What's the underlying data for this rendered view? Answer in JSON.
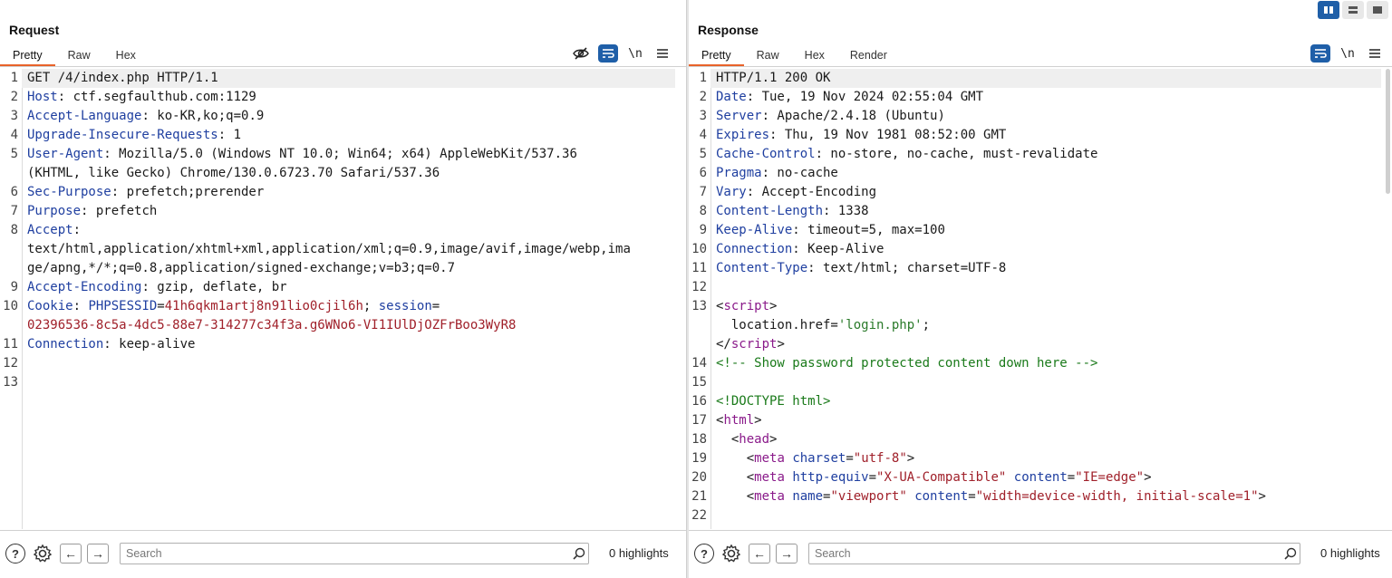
{
  "request": {
    "title": "Request",
    "tabs": [
      {
        "label": "Pretty",
        "active": true
      },
      {
        "label": "Raw"
      },
      {
        "label": "Hex"
      }
    ],
    "tools": {
      "newline_label": "\\n"
    },
    "lines": [
      {
        "n": "1",
        "segments": [
          {
            "t": "GET /4/index.php HTTP/1.1"
          }
        ],
        "highlight": true
      },
      {
        "n": "2",
        "segments": [
          {
            "t": "Host",
            "c": "hk"
          },
          {
            "t": ": ctf.segfaulthub.com:1129"
          }
        ]
      },
      {
        "n": "3",
        "segments": [
          {
            "t": "Accept-Language",
            "c": "hk"
          },
          {
            "t": ": ko-KR,ko;q=0.9"
          }
        ]
      },
      {
        "n": "4",
        "segments": [
          {
            "t": "Upgrade-Insecure-Requests",
            "c": "hk"
          },
          {
            "t": ": 1"
          }
        ]
      },
      {
        "n": "5",
        "segments": [
          {
            "t": "User-Agent",
            "c": "hk"
          },
          {
            "t": ": Mozilla/5.0 (Windows NT 10.0; Win64; x64) AppleWebKit/537.36"
          }
        ]
      },
      {
        "n": "",
        "segments": [
          {
            "t": "(KHTML, like Gecko) Chrome/130.0.6723.70 Safari/537.36"
          }
        ]
      },
      {
        "n": "6",
        "segments": [
          {
            "t": "Sec-Purpose",
            "c": "hk"
          },
          {
            "t": ": prefetch;prerender"
          }
        ]
      },
      {
        "n": "7",
        "segments": [
          {
            "t": "Purpose",
            "c": "hk"
          },
          {
            "t": ": prefetch"
          }
        ]
      },
      {
        "n": "8",
        "segments": [
          {
            "t": "Accept",
            "c": "hk"
          },
          {
            "t": ":"
          }
        ]
      },
      {
        "n": "",
        "segments": [
          {
            "t": "text/html,application/xhtml+xml,application/xml;q=0.9,image/avif,image/webp,ima"
          }
        ]
      },
      {
        "n": "",
        "segments": [
          {
            "t": "ge/apng,*/*;q=0.8,application/signed-exchange;v=b3;q=0.7"
          }
        ]
      },
      {
        "n": "9",
        "segments": [
          {
            "t": "Accept-Encoding",
            "c": "hk"
          },
          {
            "t": ": gzip, deflate, br"
          }
        ]
      },
      {
        "n": "10",
        "segments": [
          {
            "t": "Cookie",
            "c": "hk"
          },
          {
            "t": ": "
          },
          {
            "t": "PHPSESSID",
            "c": "ck"
          },
          {
            "t": "="
          },
          {
            "t": "41h6qkm1artj8n91lio0cjil6h",
            "c": "cv"
          },
          {
            "t": "; "
          },
          {
            "t": "session",
            "c": "ck"
          },
          {
            "t": "="
          }
        ]
      },
      {
        "n": "",
        "segments": [
          {
            "t": "02396536-8c5a-4dc5-88e7-314277c34f3a.g6WNo6-VI1IUlDjOZFrBoo3WyR8",
            "c": "cv"
          }
        ]
      },
      {
        "n": "11",
        "segments": [
          {
            "t": "Connection",
            "c": "hk"
          },
          {
            "t": ": keep-alive"
          }
        ]
      },
      {
        "n": "12",
        "segments": [
          {
            "t": ""
          }
        ]
      },
      {
        "n": "13",
        "segments": [
          {
            "t": ""
          }
        ]
      }
    ],
    "search": {
      "placeholder": "Search",
      "highlights": "0 highlights"
    }
  },
  "response": {
    "title": "Response",
    "tabs": [
      {
        "label": "Pretty",
        "active": true
      },
      {
        "label": "Raw"
      },
      {
        "label": "Hex"
      },
      {
        "label": "Render"
      }
    ],
    "tools": {
      "newline_label": "\\n"
    },
    "lines": [
      {
        "n": "1",
        "segments": [
          {
            "t": "HTTP/1.1 200 OK"
          }
        ],
        "highlight": true
      },
      {
        "n": "2",
        "segments": [
          {
            "t": "Date",
            "c": "hk"
          },
          {
            "t": ": Tue, 19 Nov 2024 02:55:04 GMT"
          }
        ]
      },
      {
        "n": "3",
        "segments": [
          {
            "t": "Server",
            "c": "hk"
          },
          {
            "t": ": Apache/2.4.18 (Ubuntu)"
          }
        ]
      },
      {
        "n": "4",
        "segments": [
          {
            "t": "Expires",
            "c": "hk"
          },
          {
            "t": ": Thu, 19 Nov 1981 08:52:00 GMT"
          }
        ]
      },
      {
        "n": "5",
        "segments": [
          {
            "t": "Cache-Control",
            "c": "hk"
          },
          {
            "t": ": no-store, no-cache, must-revalidate"
          }
        ]
      },
      {
        "n": "6",
        "segments": [
          {
            "t": "Pragma",
            "c": "hk"
          },
          {
            "t": ": no-cache"
          }
        ]
      },
      {
        "n": "7",
        "segments": [
          {
            "t": "Vary",
            "c": "hk"
          },
          {
            "t": ": Accept-Encoding"
          }
        ]
      },
      {
        "n": "8",
        "segments": [
          {
            "t": "Content-Length",
            "c": "hk"
          },
          {
            "t": ": 1338"
          }
        ]
      },
      {
        "n": "9",
        "segments": [
          {
            "t": "Keep-Alive",
            "c": "hk"
          },
          {
            "t": ": timeout=5, max=100"
          }
        ]
      },
      {
        "n": "10",
        "segments": [
          {
            "t": "Connection",
            "c": "hk"
          },
          {
            "t": ": Keep-Alive"
          }
        ]
      },
      {
        "n": "11",
        "segments": [
          {
            "t": "Content-Type",
            "c": "hk"
          },
          {
            "t": ": text/html; charset=UTF-8"
          }
        ]
      },
      {
        "n": "12",
        "segments": [
          {
            "t": ""
          }
        ]
      },
      {
        "n": "13",
        "segments": [
          {
            "t": "<"
          },
          {
            "t": "script",
            "c": "tg"
          },
          {
            "t": ">"
          }
        ]
      },
      {
        "n": "",
        "segments": [
          {
            "t": "  location.href="
          },
          {
            "t": "'login.php'",
            "c": "av"
          },
          {
            "t": ";"
          }
        ]
      },
      {
        "n": "",
        "segments": [
          {
            "t": "</"
          },
          {
            "t": "script",
            "c": "tg"
          },
          {
            "t": ">"
          }
        ]
      },
      {
        "n": "14",
        "segments": [
          {
            "t": "<!-- Show password protected content down here -->",
            "c": "cm"
          }
        ]
      },
      {
        "n": "15",
        "segments": [
          {
            "t": ""
          }
        ]
      },
      {
        "n": "16",
        "segments": [
          {
            "t": "<!DOCTYPE html>",
            "c": "cm"
          }
        ]
      },
      {
        "n": "17",
        "segments": [
          {
            "t": "<"
          },
          {
            "t": "html",
            "c": "tg"
          },
          {
            "t": ">"
          }
        ]
      },
      {
        "n": "18",
        "segments": [
          {
            "t": "  <"
          },
          {
            "t": "head",
            "c": "tg"
          },
          {
            "t": ">"
          }
        ]
      },
      {
        "n": "19",
        "segments": [
          {
            "t": "    <"
          },
          {
            "t": "meta",
            "c": "tg"
          },
          {
            "t": " "
          },
          {
            "t": "charset",
            "c": "at"
          },
          {
            "t": "="
          },
          {
            "t": "\"utf-8\"",
            "c": "cv"
          },
          {
            "t": ">"
          }
        ]
      },
      {
        "n": "20",
        "segments": [
          {
            "t": "    <"
          },
          {
            "t": "meta",
            "c": "tg"
          },
          {
            "t": " "
          },
          {
            "t": "http-equiv",
            "c": "at"
          },
          {
            "t": "="
          },
          {
            "t": "\"X-UA-Compatible\"",
            "c": "cv"
          },
          {
            "t": " "
          },
          {
            "t": "content",
            "c": "at"
          },
          {
            "t": "="
          },
          {
            "t": "\"IE=edge\"",
            "c": "cv"
          },
          {
            "t": ">"
          }
        ]
      },
      {
        "n": "21",
        "segments": [
          {
            "t": "    <"
          },
          {
            "t": "meta",
            "c": "tg"
          },
          {
            "t": " "
          },
          {
            "t": "name",
            "c": "at"
          },
          {
            "t": "="
          },
          {
            "t": "\"viewport\"",
            "c": "cv"
          },
          {
            "t": " "
          },
          {
            "t": "content",
            "c": "at"
          },
          {
            "t": "="
          },
          {
            "t": "\"width=device-width, initial-scale=1\"",
            "c": "cv"
          },
          {
            "t": ">"
          }
        ]
      },
      {
        "n": "22",
        "segments": [
          {
            "t": ""
          }
        ]
      }
    ],
    "search": {
      "placeholder": "Search",
      "highlights": "0 highlights"
    }
  },
  "colors": {
    "accent": "#e8632a",
    "tool_blue": "#1f5fa8"
  }
}
